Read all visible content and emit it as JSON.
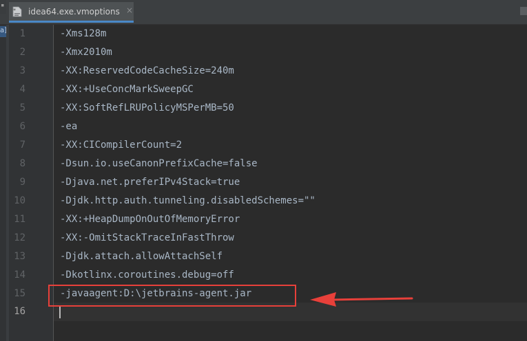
{
  "tab": {
    "title": "idea64.exe.vmoptions",
    "close_glyph": "×",
    "icon": "vmoptions-file-icon"
  },
  "side_badge": "a]",
  "editor": {
    "current_line": 16,
    "lines": [
      {
        "number": "1",
        "text": "-Xms128m"
      },
      {
        "number": "2",
        "text": "-Xmx2010m"
      },
      {
        "number": "3",
        "text": "-XX:ReservedCodeCacheSize=240m"
      },
      {
        "number": "4",
        "text": "-XX:+UseConcMarkSweepGC"
      },
      {
        "number": "5",
        "text": "-XX:SoftRefLRUPolicyMSPerMB=50"
      },
      {
        "number": "6",
        "text": "-ea"
      },
      {
        "number": "7",
        "text": "-XX:CICompilerCount=2"
      },
      {
        "number": "8",
        "text": "-Dsun.io.useCanonPrefixCache=false"
      },
      {
        "number": "9",
        "text": "-Djava.net.preferIPv4Stack=true"
      },
      {
        "number": "10",
        "text": "-Djdk.http.auth.tunneling.disabledSchemes=\"\""
      },
      {
        "number": "11",
        "text": "-XX:+HeapDumpOnOutOfMemoryError"
      },
      {
        "number": "12",
        "text": "-XX:-OmitStackTraceInFastThrow"
      },
      {
        "number": "13",
        "text": "-Djdk.attach.allowAttachSelf"
      },
      {
        "number": "14",
        "text": "-Dkotlinx.coroutines.debug=off"
      },
      {
        "number": "15",
        "text": "-javaagent:D:\\jetbrains-agent.jar"
      },
      {
        "number": "16",
        "text": ""
      }
    ]
  },
  "annotation": {
    "highlighted_line": 15,
    "color": "#e8403a",
    "arrow_icon": "red-arrow-icon"
  },
  "colors": {
    "editor_background": "#2b2b2b",
    "gutter_background": "#313335",
    "code_text": "#a9b7c6",
    "line_number": "#606366",
    "tab_underline": "#4a88c7"
  }
}
